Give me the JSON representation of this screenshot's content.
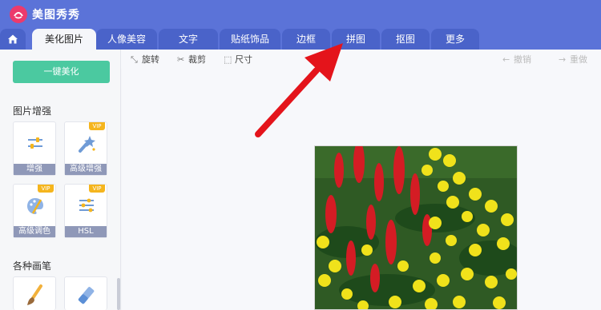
{
  "app": {
    "name": "美图秀秀"
  },
  "tabs": [
    {
      "label": "美化图片",
      "active": true
    },
    {
      "label": "人像美容",
      "active": false
    },
    {
      "label": "文字",
      "active": false
    },
    {
      "label": "贴纸饰品",
      "active": false
    },
    {
      "label": "边框",
      "active": false
    },
    {
      "label": "拼图",
      "active": false
    },
    {
      "label": "抠图",
      "active": false
    },
    {
      "label": "更多",
      "active": false
    }
  ],
  "sidebar": {
    "one_key_label": "一键美化",
    "section_enhance": "图片增强",
    "tools": [
      {
        "label": "增强",
        "vip": false,
        "icon": "sliders-icon"
      },
      {
        "label": "高级增强",
        "vip": true,
        "icon": "magic-wand-icon"
      },
      {
        "label": "高级调色",
        "vip": true,
        "icon": "palette-icon"
      },
      {
        "label": "HSL",
        "vip": true,
        "icon": "equalizer-icon"
      }
    ],
    "vip_badge": "VIP",
    "section_brush": "各种画笔",
    "brush_tools": [
      "brush-icon",
      "eraser-icon"
    ]
  },
  "toolbar": {
    "rotate": "旋转",
    "crop": "裁剪",
    "resize": "尺寸",
    "undo": "撤销",
    "redo": "重做"
  },
  "colors": {
    "header_blue": "#5b73d8",
    "accent_green": "#4bc9a0",
    "vip_gold": "#f5b51d",
    "arrow_red": "#e4141b"
  }
}
